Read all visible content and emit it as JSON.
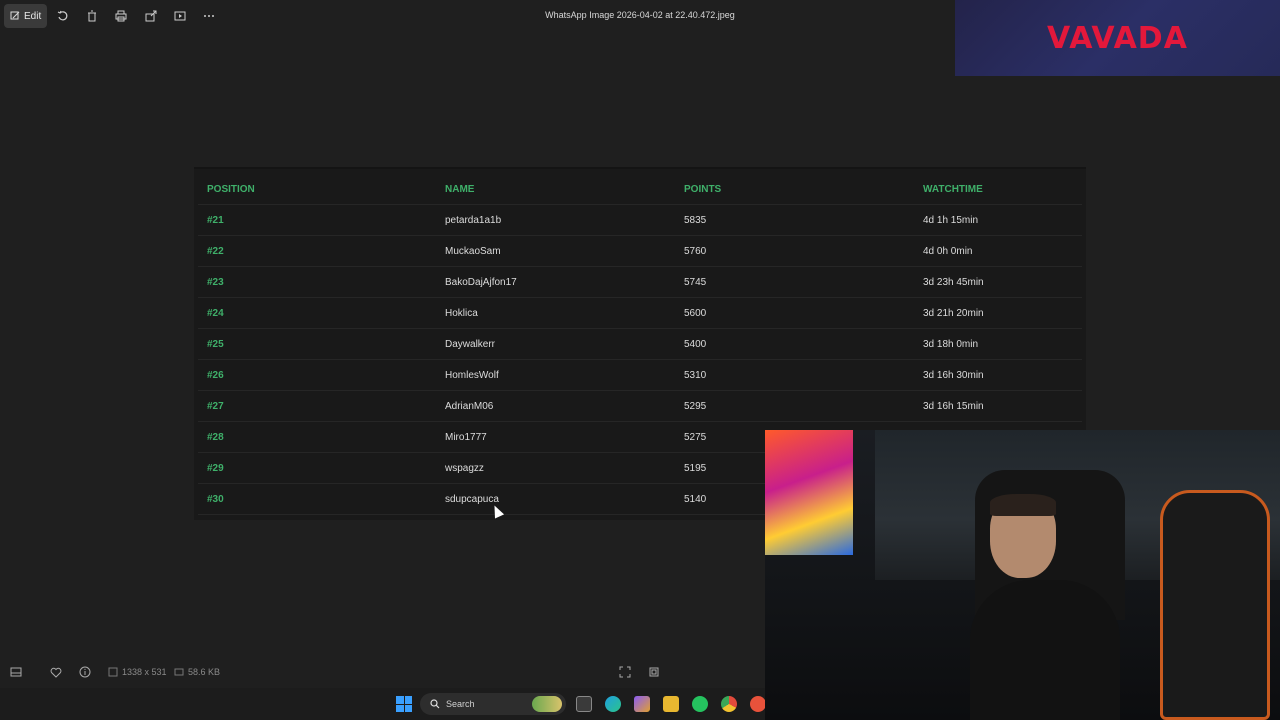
{
  "toolbar": {
    "edit_label": "Edit",
    "file_title": "WhatsApp Image 2026-04-02 at 22.40.472.jpeg"
  },
  "brand": {
    "logo_text": "VAVADA",
    "color": "#e3183b"
  },
  "leaderboard": {
    "accent_color": "#3fb06a",
    "columns": [
      "POSITION",
      "NAME",
      "POINTS",
      "WATCHTIME"
    ],
    "rows": [
      {
        "position": "#21",
        "name": "petarda1a1b",
        "points": "5835",
        "watchtime": "4d 1h 15min"
      },
      {
        "position": "#22",
        "name": "MuckaoSam",
        "points": "5760",
        "watchtime": "4d 0h 0min"
      },
      {
        "position": "#23",
        "name": "BakoDajAjfon17",
        "points": "5745",
        "watchtime": "3d 23h 45min"
      },
      {
        "position": "#24",
        "name": "Hoklica",
        "points": "5600",
        "watchtime": "3d 21h 20min"
      },
      {
        "position": "#25",
        "name": "Daywalkerr",
        "points": "5400",
        "watchtime": "3d 18h 0min"
      },
      {
        "position": "#26",
        "name": "HomlesWolf",
        "points": "5310",
        "watchtime": "3d 16h 30min"
      },
      {
        "position": "#27",
        "name": "AdrianM06",
        "points": "5295",
        "watchtime": "3d 16h 15min"
      },
      {
        "position": "#28",
        "name": "Miro1777",
        "points": "5275",
        "watchtime": ""
      },
      {
        "position": "#29",
        "name": "wspagzz",
        "points": "5195",
        "watchtime": ""
      },
      {
        "position": "#30",
        "name": "sdupcapuca",
        "points": "5140",
        "watchtime": ""
      }
    ]
  },
  "statusbar": {
    "dimensions": "1338 x 531",
    "file_size": "58.6 KB"
  },
  "taskbar": {
    "search_label": "Search"
  }
}
